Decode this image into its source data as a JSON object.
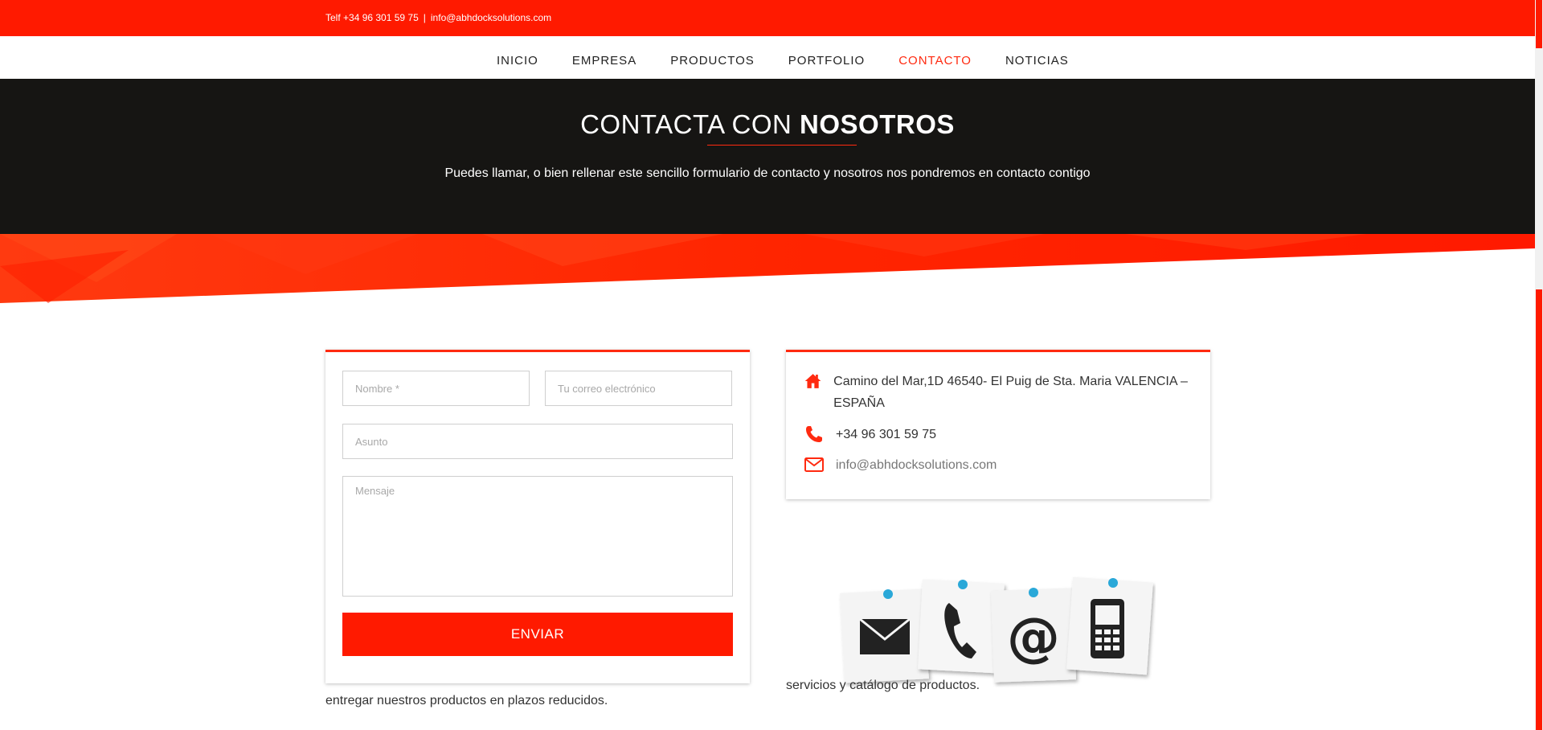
{
  "topbar": {
    "phone": "Telf +34 96 301 59 75",
    "separator": "|",
    "email": "info@abhdocksolutions.com"
  },
  "nav": {
    "items": [
      {
        "label": "INICIO"
      },
      {
        "label": "EMPRESA"
      },
      {
        "label": "PRODUCTOS"
      },
      {
        "label": "PORTFOLIO"
      },
      {
        "label": "CONTACTO"
      },
      {
        "label": "NOTICIAS"
      }
    ],
    "active": "CONTACTO"
  },
  "hero": {
    "title_light": "CONTACTA CON ",
    "title_bold": "NOSOTROS",
    "subtitle": "Puedes llamar, o bien rellenar este sencillo formulario de contacto y nosotros nos pondremos en contacto contigo"
  },
  "form": {
    "name_placeholder": "Nombre *",
    "email_placeholder": "Tu correo electrónico",
    "subject_placeholder": "Asunto",
    "message_placeholder": "Mensaje",
    "submit_label": "ENVIAR"
  },
  "info": {
    "address": "Camino del Mar,1D 46540- El Puig de Sta. Maria VALENCIA – ESPAÑA",
    "phone": "+34 96 301 59 75",
    "email": "info@abhdocksolutions.com"
  },
  "footer": {
    "left_text": "entregar nuestros productos en plazos reducidos.",
    "right_text": "servicios y catálogo de productos."
  },
  "colors": {
    "accent": "#ff1a00",
    "hero_bg": "#161513"
  }
}
